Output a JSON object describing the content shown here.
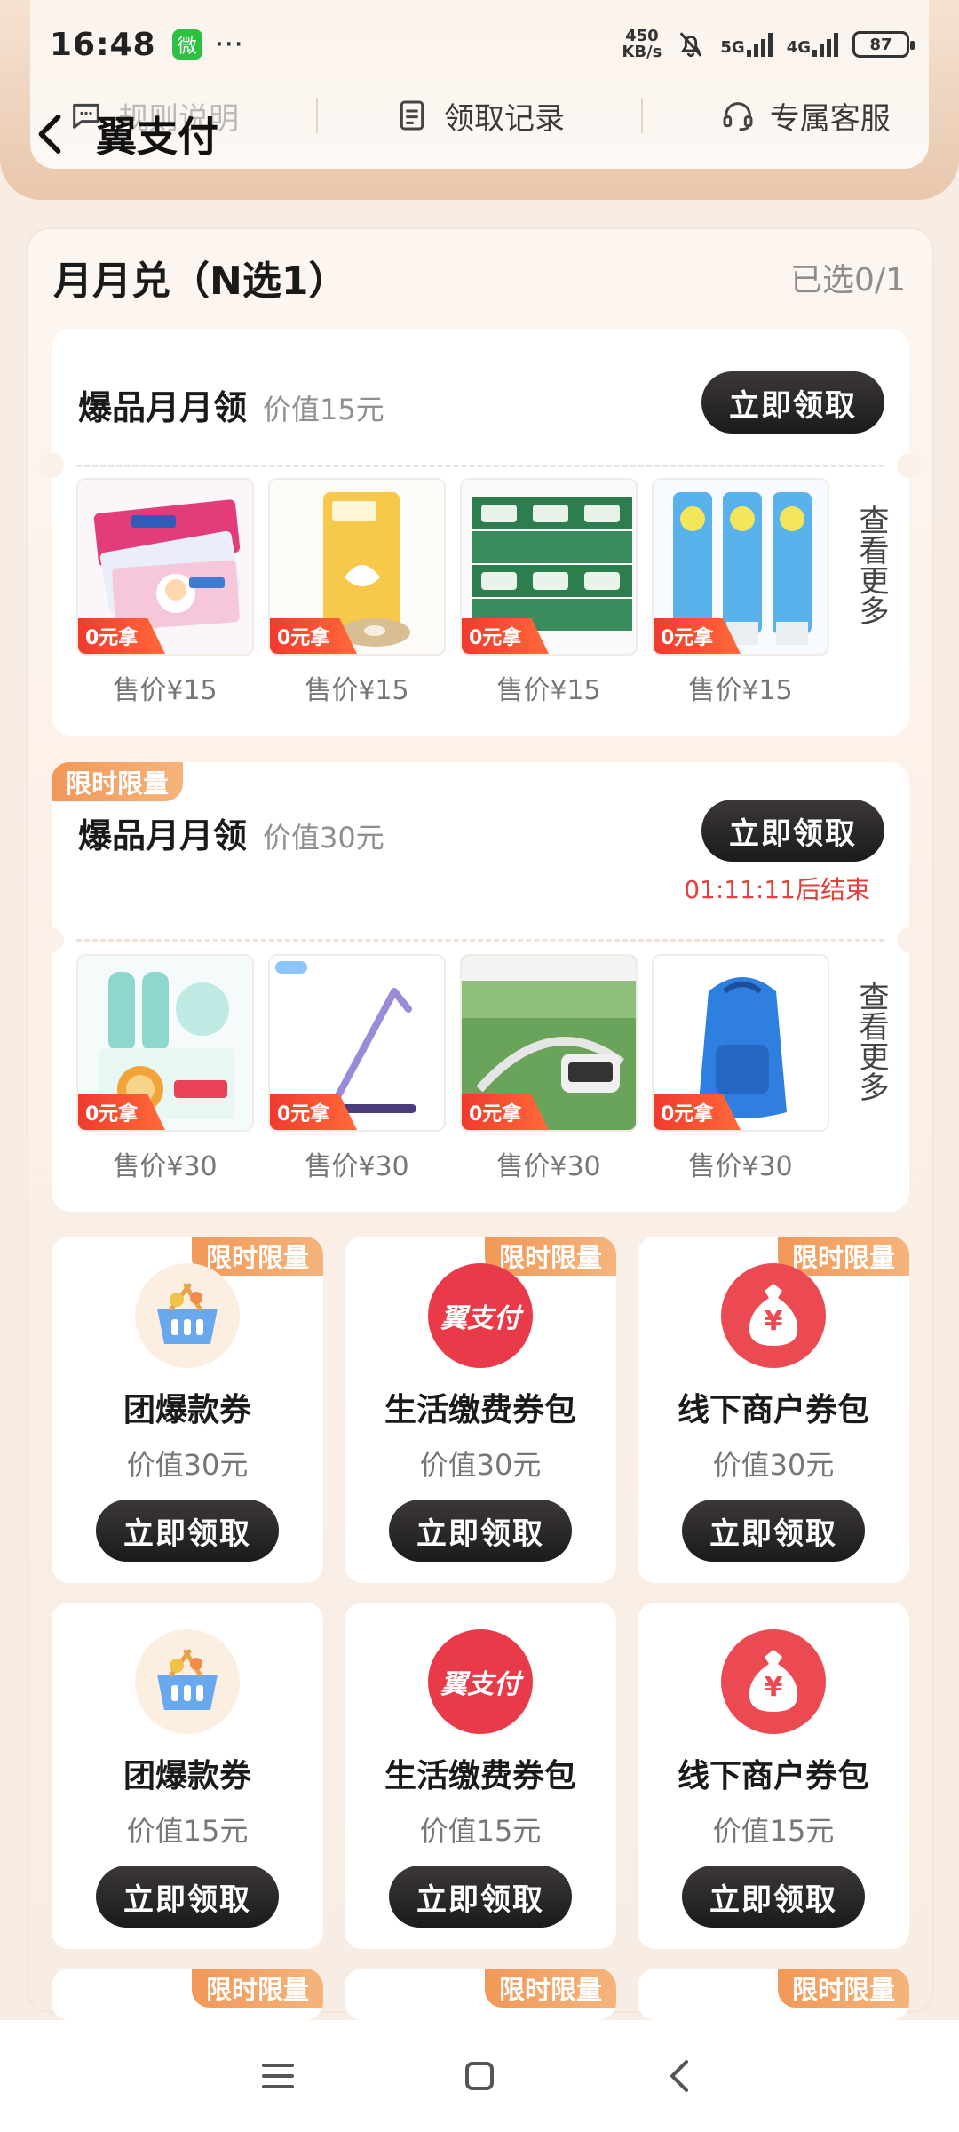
{
  "status_bar": {
    "time": "16:48",
    "wechat_label": "微",
    "more_dots": "···",
    "net_speed_value": "450",
    "net_speed_unit": "KB/s",
    "signal_5g": "5G",
    "signal_4g": "4G",
    "battery": "87"
  },
  "header": {
    "back_title": "翼支付",
    "nav_items": [
      "规则说明",
      "领取记录",
      "专属客服"
    ]
  },
  "section": {
    "title": "月月兑（N选1）",
    "selected_count": "已选0/1"
  },
  "offers": [
    {
      "name": "爆品月月领",
      "value": "价值15元",
      "button": "立即领取",
      "zero_tag": "0元拿",
      "more_label": "查看更多",
      "products": [
        {
          "price": "售价¥15"
        },
        {
          "price": "售价¥15"
        },
        {
          "price": "售价¥15"
        },
        {
          "price": "售价¥15"
        }
      ]
    },
    {
      "ribbon": "限时限量",
      "name": "爆品月月领",
      "value": "价值30元",
      "button": "立即领取",
      "countdown": "01:11:11后结束",
      "zero_tag": "0元拿",
      "more_label": "查看更多",
      "products": [
        {
          "price": "售价¥30"
        },
        {
          "price": "售价¥30"
        },
        {
          "price": "售价¥30"
        },
        {
          "price": "售价¥30"
        }
      ]
    }
  ],
  "coupons": [
    {
      "ribbon": "限时限量",
      "name": "团爆款券",
      "value": "价值30元",
      "button": "立即领取",
      "icon": "basket-icon"
    },
    {
      "ribbon": "限时限量",
      "name": "生活缴费券包",
      "value": "价值30元",
      "button": "立即领取",
      "icon": "yizhifu-logo-icon",
      "logo_text": "翼支付"
    },
    {
      "ribbon": "限时限量",
      "name": "线下商户券包",
      "value": "价值30元",
      "button": "立即领取",
      "icon": "money-bag-icon",
      "logo_text": "¥"
    },
    {
      "name": "团爆款券",
      "value": "价值15元",
      "button": "立即领取",
      "icon": "basket-icon"
    },
    {
      "name": "生活缴费券包",
      "value": "价值15元",
      "button": "立即领取",
      "icon": "yizhifu-logo-icon",
      "logo_text": "翼支付"
    },
    {
      "name": "线下商户券包",
      "value": "价值15元",
      "button": "立即领取",
      "icon": "money-bag-icon",
      "logo_text": "¥"
    },
    {
      "ribbon": "限时限量"
    },
    {
      "ribbon": "限时限量"
    },
    {
      "ribbon": "限时限量"
    }
  ],
  "colors": {
    "accent_red": "#e2403a",
    "ribbon_orange": "#f19857",
    "button_dark": "#1c1a1a"
  }
}
